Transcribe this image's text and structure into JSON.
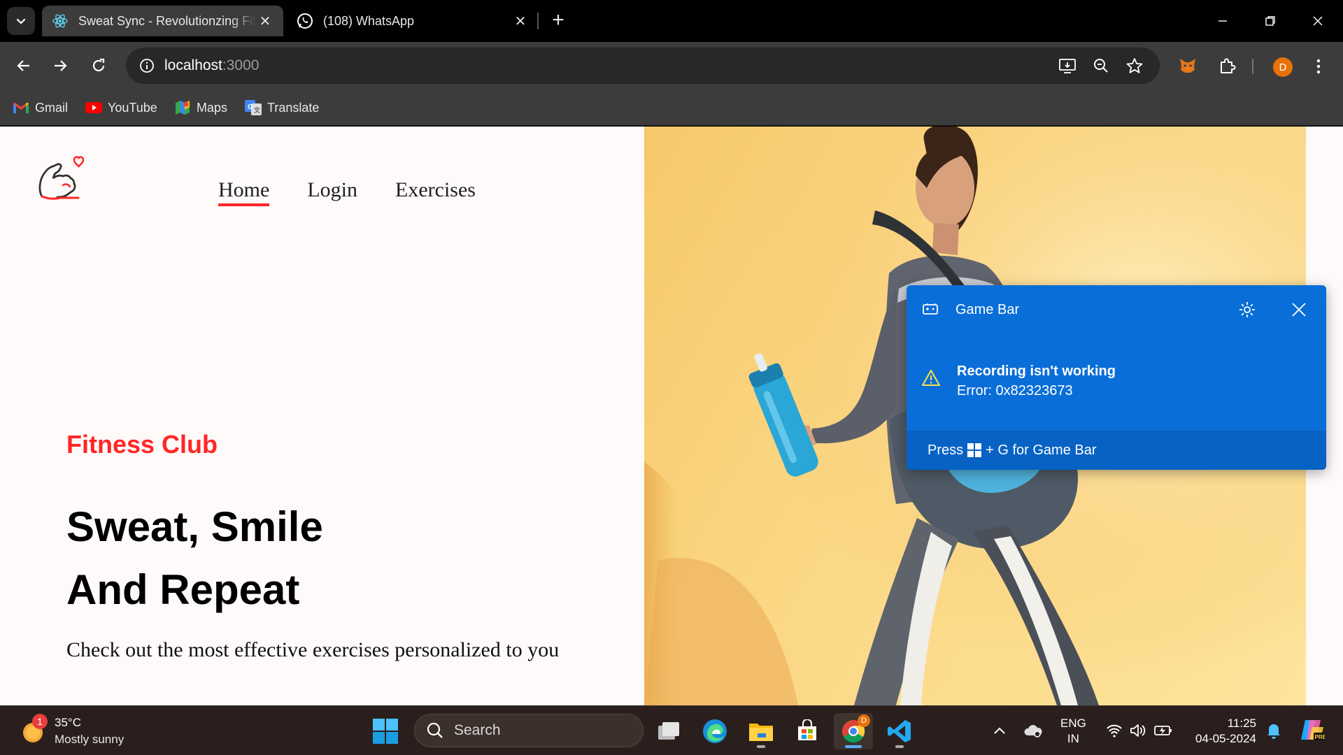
{
  "browser": {
    "tabs": [
      {
        "title": "Sweat Sync - Revolutionzing Fitness",
        "active": true
      },
      {
        "title": "(108) WhatsApp",
        "active": false
      }
    ],
    "url_host": "localhost",
    "url_port": ":3000",
    "bookmarks": [
      {
        "label": "Gmail",
        "icon": "gmail-icon"
      },
      {
        "label": "YouTube",
        "icon": "youtube-icon"
      },
      {
        "label": "Maps",
        "icon": "maps-icon"
      },
      {
        "label": "Translate",
        "icon": "translate-icon"
      }
    ],
    "profile_initial": "D"
  },
  "page": {
    "nav": [
      {
        "label": "Home",
        "active": true
      },
      {
        "label": "Login",
        "active": false
      },
      {
        "label": "Exercises",
        "active": false
      }
    ],
    "hero": {
      "kicker": "Fitness Club",
      "title_line1": "Sweat, Smile",
      "title_line2": "And Repeat",
      "subtitle": "Check out the most effective exercises personalized to you"
    },
    "accent_color": "#ff2625"
  },
  "gamebar": {
    "title": "Game Bar",
    "heading": "Recording isn't working",
    "error": "Error: 0x82323673",
    "footer_prefix": "Press",
    "footer_suffix": "+ G for Game Bar",
    "bg_color": "#0a6ed8"
  },
  "taskbar": {
    "weather_badge": "1",
    "temperature": "35°C",
    "condition": "Mostly sunny",
    "search_placeholder": "Search",
    "chrome_badge": "D",
    "lang_line1": "ENG",
    "lang_line2": "IN",
    "time": "11:25",
    "date": "04-05-2024"
  }
}
